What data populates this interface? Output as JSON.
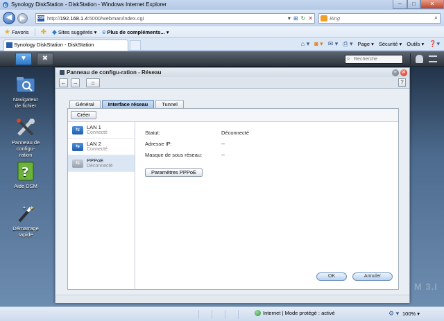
{
  "browser": {
    "title": "Synology DiskStation - DiskStation - Windows Internet Explorer",
    "url_prefix": "http://",
    "url_host": "192.168.1.4",
    "url_rest": ":5000/webman/index.cgi",
    "search_placeholder": "Bing",
    "favorites": {
      "label": "Favoris",
      "suggested": "Sites suggérés ▾",
      "addons": "Plus de compléments... ▾"
    },
    "tab_label": "Synology DiskStation - DiskStation",
    "commands": {
      "page": "Page ▾",
      "security": "Sécurité ▾",
      "tools": "Outils ▾"
    },
    "status": {
      "zone": "Internet | Mode protégé : activé",
      "zoom": "100% ▾"
    }
  },
  "dsm": {
    "search_placeholder": "Recherche",
    "watermark": "M 3.I",
    "desktop": [
      {
        "label_l1": "Navigateur",
        "label_l2": "de fichier",
        "label_l3": ""
      },
      {
        "label_l1": "Panneau de",
        "label_l2": "configu-",
        "label_l3": "ration"
      },
      {
        "label_l1": "Aide DSM",
        "label_l2": "",
        "label_l3": ""
      },
      {
        "label_l1": "Démarrage",
        "label_l2": "rapide",
        "label_l3": ""
      }
    ]
  },
  "window": {
    "title": "Panneau de configu-ration - Réseau",
    "tabs": [
      "Général",
      "Interface réseau",
      "Tunnel"
    ],
    "create_label": "Créer",
    "interfaces": [
      {
        "name": "LAN 1",
        "status": "Connecté"
      },
      {
        "name": "LAN 2",
        "status": "Connecté"
      },
      {
        "name": "PPPoE",
        "status": "Déconnecté"
      }
    ],
    "details": {
      "status_label": "Statut:",
      "status_value": "Déconnecté",
      "ip_label": "Adresse IP:",
      "ip_value": "--",
      "mask_label": "Masque de sous réseau:",
      "mask_value": "--"
    },
    "pppoe_button": "Paramètres PPPoE",
    "ok_button": "OK",
    "cancel_button": "Annuler"
  }
}
